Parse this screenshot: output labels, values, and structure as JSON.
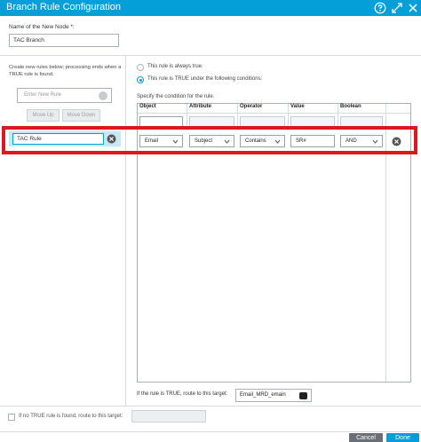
{
  "window": {
    "title": "Branch Rule Configuration",
    "icons": [
      "help-icon",
      "expand-icon",
      "close-icon"
    ]
  },
  "node": {
    "label": "Name of the New Node *:",
    "value": "TAC Branch"
  },
  "rules_panel": {
    "description": "Create new rules below; processing ends when a TRUE rule is found.",
    "new_rule_placeholder": "Enter New Rule",
    "move_up_label": "Move Up",
    "move_down_label": "Move Down",
    "rules": [
      {
        "name": "TAC Rule",
        "selected": true
      }
    ]
  },
  "condition_mode": {
    "always_true_label": "This rule is always true.",
    "conditional_label": "This rule is TRUE under the following conditions:",
    "selected": "conditional"
  },
  "conditions": {
    "spec_label": "Specify the condition for the rule.",
    "headers": [
      "Object",
      "Attribute",
      "Operator",
      "Value",
      "Boolean"
    ],
    "rows": [
      {
        "object": "Email",
        "attribute": "Subject",
        "operator": "Contains",
        "value": "SR#",
        "boolean": "AND"
      }
    ]
  },
  "target": {
    "label": "If the rule is TRUE, route to this target:",
    "value": "Email_MRD_emain"
  },
  "fallback": {
    "label": "If no TRUE rule is found, route to this target:",
    "checked": false
  },
  "footer": {
    "cancel_label": "Cancel",
    "done_label": "Done"
  },
  "colors": {
    "accent": "#049fd9",
    "highlight": "#e0161e",
    "selected_row": "#c6e8f5"
  }
}
